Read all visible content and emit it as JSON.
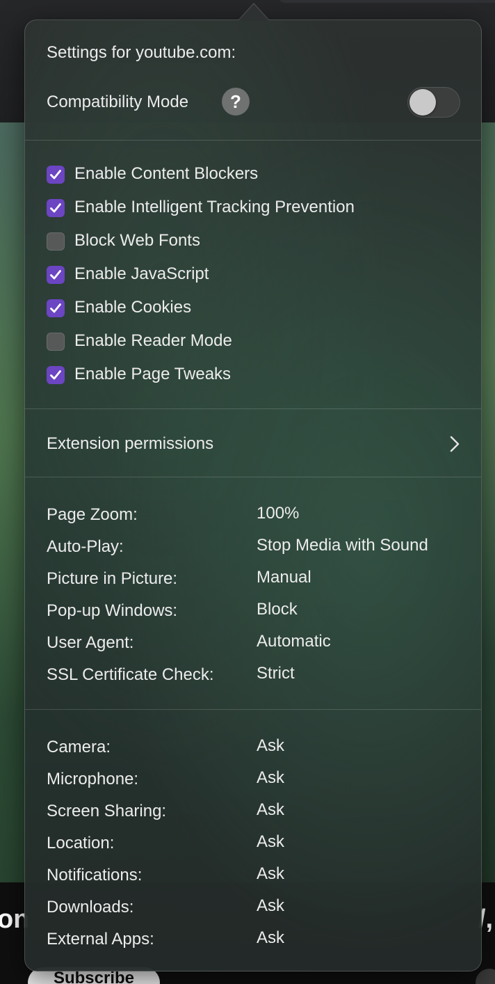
{
  "popover": {
    "title": "Settings for youtube.com:",
    "compatibility": {
      "label": "Compatibility Mode",
      "help_glyph": "?",
      "enabled": false
    },
    "checkboxes": [
      {
        "label": "Enable Content Blockers",
        "checked": true
      },
      {
        "label": "Enable Intelligent Tracking Prevention",
        "checked": true
      },
      {
        "label": "Block Web Fonts",
        "checked": false
      },
      {
        "label": "Enable JavaScript",
        "checked": true
      },
      {
        "label": "Enable Cookies",
        "checked": true
      },
      {
        "label": "Enable Reader Mode",
        "checked": false
      },
      {
        "label": "Enable Page Tweaks",
        "checked": true
      }
    ],
    "extension_permissions": {
      "label": "Extension permissions",
      "icon": "chevron-right-icon"
    },
    "page_settings": [
      {
        "key": "Page Zoom:",
        "value": "100%"
      },
      {
        "key": "Auto-Play:",
        "value": "Stop Media with Sound"
      },
      {
        "key": "Picture in Picture:",
        "value": "Manual"
      },
      {
        "key": "Pop-up Windows:",
        "value": "Block"
      },
      {
        "key": "User Agent:",
        "value": "Automatic"
      },
      {
        "key": "SSL Certificate Check:",
        "value": "Strict"
      }
    ],
    "permissions": [
      {
        "key": "Camera:",
        "value": "Ask"
      },
      {
        "key": "Microphone:",
        "value": "Ask"
      },
      {
        "key": "Screen Sharing:",
        "value": "Ask"
      },
      {
        "key": "Location:",
        "value": "Ask"
      },
      {
        "key": "Notifications:",
        "value": "Ask"
      },
      {
        "key": "Downloads:",
        "value": "Ask"
      },
      {
        "key": "External Apps:",
        "value": "Ask"
      }
    ]
  },
  "background": {
    "left_fragment": "on",
    "right_fragment": "/,",
    "subscribe_label": "Subscribe"
  },
  "colors": {
    "checkbox_on": "#6b45c2",
    "checkbox_off": "#565958",
    "text": "#ececec"
  }
}
